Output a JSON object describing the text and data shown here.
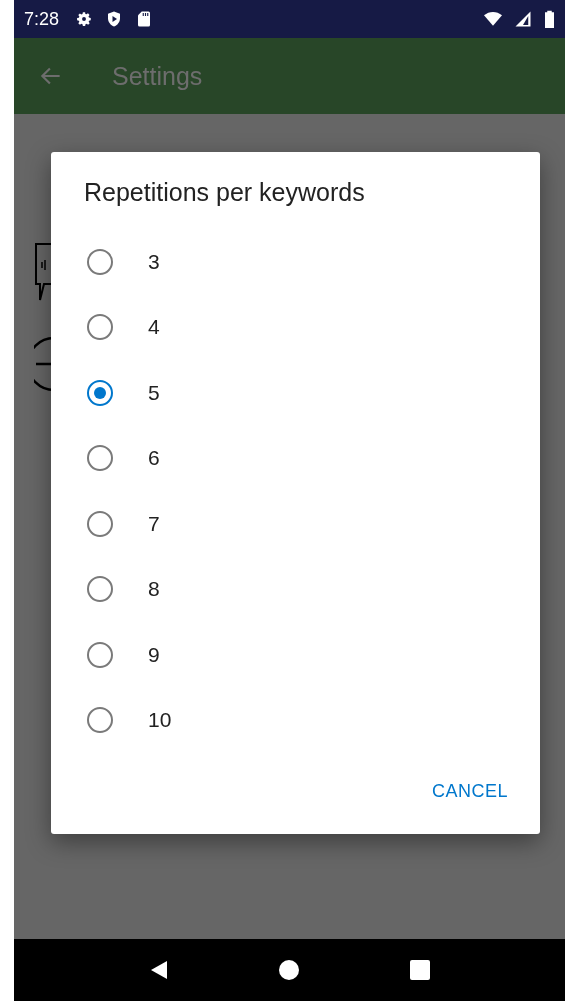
{
  "status_bar": {
    "time": "7:28"
  },
  "app_bar": {
    "title": "Settings"
  },
  "dialog": {
    "title": "Repetitions per keywords",
    "options": [
      {
        "label": "3",
        "selected": false
      },
      {
        "label": "4",
        "selected": false
      },
      {
        "label": "5",
        "selected": true
      },
      {
        "label": "6",
        "selected": false
      },
      {
        "label": "7",
        "selected": false
      },
      {
        "label": "8",
        "selected": false
      },
      {
        "label": "9",
        "selected": false
      },
      {
        "label": "10",
        "selected": false
      }
    ],
    "buttons": [
      "CANCEL"
    ]
  }
}
